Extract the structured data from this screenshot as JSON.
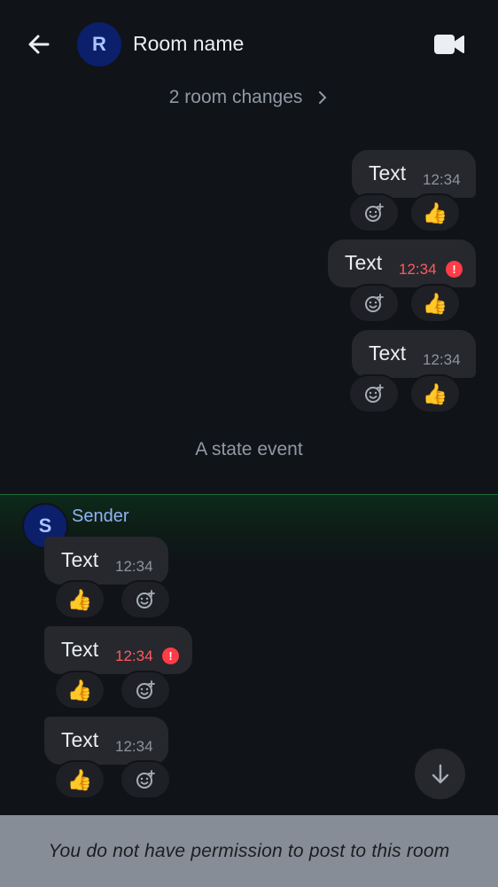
{
  "header": {
    "room_avatar_initial": "R",
    "room_name": "Room name",
    "back_icon": "arrow-left-icon",
    "video_icon": "video-call-icon"
  },
  "room_changes": {
    "label": "2 room changes"
  },
  "outgoing_messages": [
    {
      "text": "Text",
      "time": "12:34",
      "failed": false,
      "reactions": [
        "add-reaction",
        "👍"
      ]
    },
    {
      "text": "Text",
      "time": "12:34",
      "failed": true,
      "reactions": [
        "add-reaction",
        "👍"
      ]
    },
    {
      "text": "Text",
      "time": "12:34",
      "failed": false,
      "reactions": [
        "add-reaction",
        "👍"
      ]
    }
  ],
  "state_event": {
    "label": "A state event"
  },
  "sender": {
    "avatar_initial": "S",
    "name": "Sender"
  },
  "incoming_messages": [
    {
      "text": "Text",
      "time": "12:34",
      "failed": false,
      "reactions": [
        "👍",
        "add-reaction"
      ]
    },
    {
      "text": "Text",
      "time": "12:34",
      "failed": true,
      "reactions": [
        "👍",
        "add-reaction"
      ]
    },
    {
      "text": "Text",
      "time": "12:34",
      "failed": false,
      "reactions": [
        "👍",
        "add-reaction"
      ]
    }
  ],
  "error_glyph": "!",
  "thumbs_up": "👍",
  "composer": {
    "notice": "You do not have permission to post to this room"
  },
  "colors": {
    "background": "#101318",
    "bubble": "#26282d",
    "error": "#ff3b47",
    "avatar_bg": "#0b1f6b",
    "sender_name": "#8fb4f5"
  }
}
